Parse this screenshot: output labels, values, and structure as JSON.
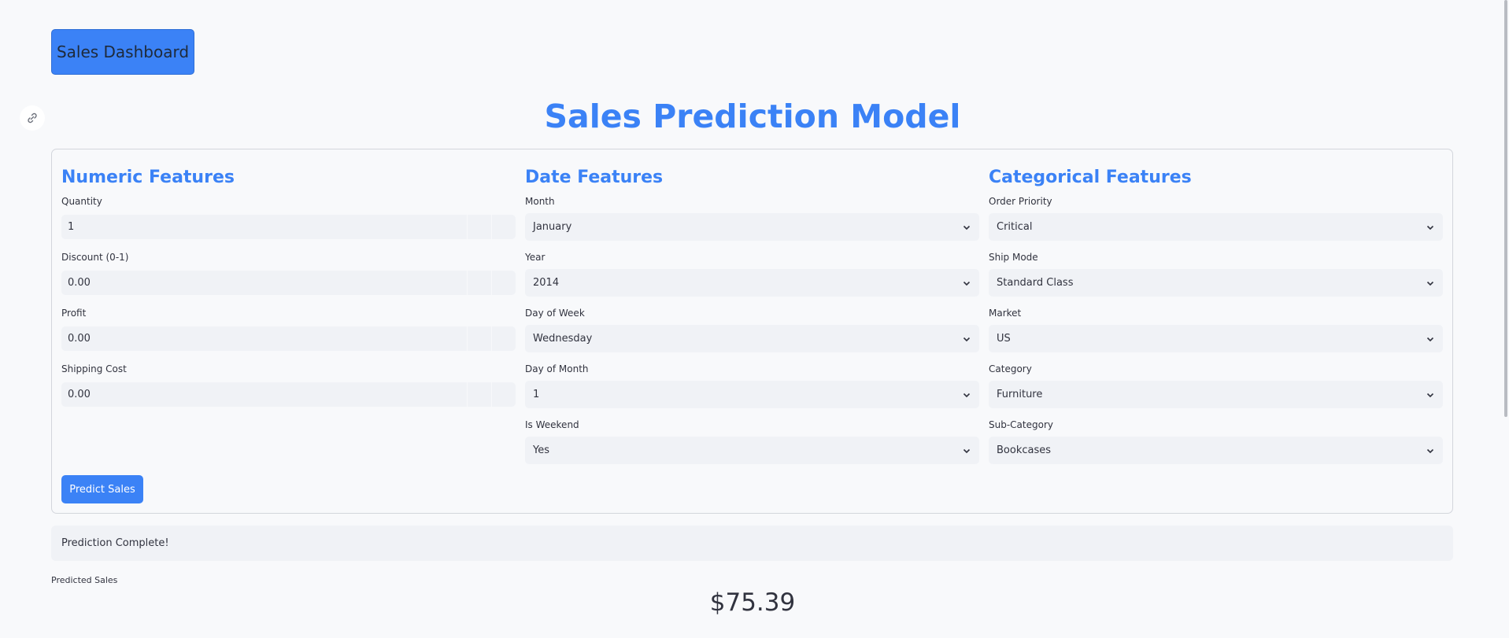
{
  "nav": {
    "dashboard_label": "Sales Dashboard"
  },
  "title": "Sales Prediction Model",
  "numeric": {
    "title": "Numeric Features",
    "fields": [
      {
        "label": "Quantity",
        "value": "1"
      },
      {
        "label": "Discount (0-1)",
        "value": "0.00"
      },
      {
        "label": "Profit",
        "value": "0.00"
      },
      {
        "label": "Shipping Cost",
        "value": "0.00"
      }
    ]
  },
  "date": {
    "title": "Date Features",
    "fields": [
      {
        "label": "Month",
        "value": "January"
      },
      {
        "label": "Year",
        "value": "2014"
      },
      {
        "label": "Day of Week",
        "value": "Wednesday"
      },
      {
        "label": "Day of Month",
        "value": "1"
      },
      {
        "label": "Is Weekend",
        "value": "Yes"
      }
    ]
  },
  "categorical": {
    "title": "Categorical Features",
    "fields": [
      {
        "label": "Order Priority",
        "value": "Critical"
      },
      {
        "label": "Ship Mode",
        "value": "Standard Class"
      },
      {
        "label": "Market",
        "value": "US"
      },
      {
        "label": "Category",
        "value": "Furniture"
      },
      {
        "label": "Sub-Category",
        "value": "Bookcases"
      }
    ]
  },
  "predict_label": "Predict Sales",
  "status": "Prediction Complete!",
  "result": {
    "label": "Predicted Sales",
    "value": "$75.39"
  },
  "colors": {
    "accent": "#3b82f6",
    "input_bg": "#f0f2f6",
    "page_bg": "#f8f9fb"
  },
  "icons": {
    "anchor": "link-icon",
    "dropdown": "chevron-down-icon"
  }
}
